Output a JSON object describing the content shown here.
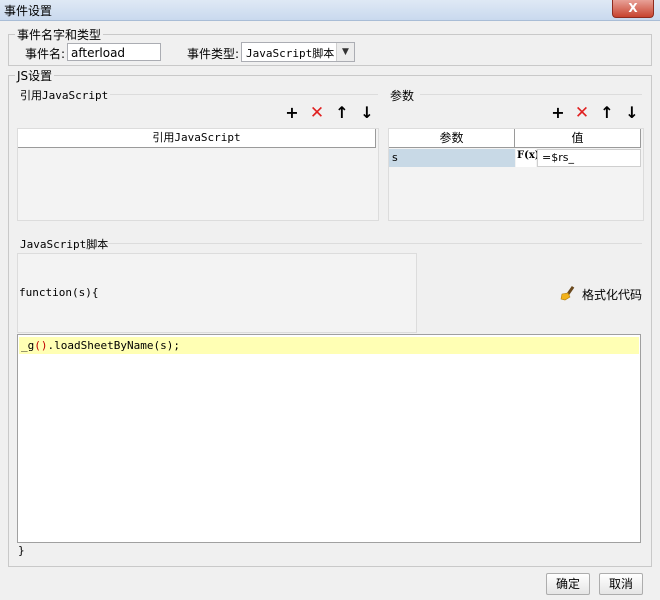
{
  "window": {
    "title": "事件设置",
    "close_label": "X"
  },
  "event_group": {
    "legend": "事件名字和类型",
    "name_label": "事件名:",
    "name_value": "afterload",
    "type_label": "事件类型:",
    "type_value": "JavaScript脚本"
  },
  "js_group": {
    "legend": "JS设置"
  },
  "ref_js": {
    "section_label": "引用JavaScript",
    "column_header": "引用JavaScript"
  },
  "params": {
    "section_label": "参数",
    "columns": [
      "参数",
      "值"
    ],
    "rows": [
      {
        "name": "s",
        "formula_icon": "F(x)",
        "value": "=$rs_"
      }
    ]
  },
  "script": {
    "section_label": "JavaScript脚本",
    "signature": "function(s){",
    "format_label": "格式化代码",
    "code_prefix": "_g",
    "code_parens": "()",
    "code_suffix": ".loadSheetByName(s);",
    "closing_brace": "}"
  },
  "footer": {
    "ok": "确定",
    "cancel": "取消"
  },
  "colors": {
    "code_highlight": "#ffffb4",
    "delete_icon": "#e02020",
    "param_selected": "#c8d9e6"
  },
  "icons": {
    "add": "plus-icon",
    "delete": "delete-icon",
    "up": "arrow-up-icon",
    "down": "arrow-down-icon",
    "format": "broom-icon"
  }
}
